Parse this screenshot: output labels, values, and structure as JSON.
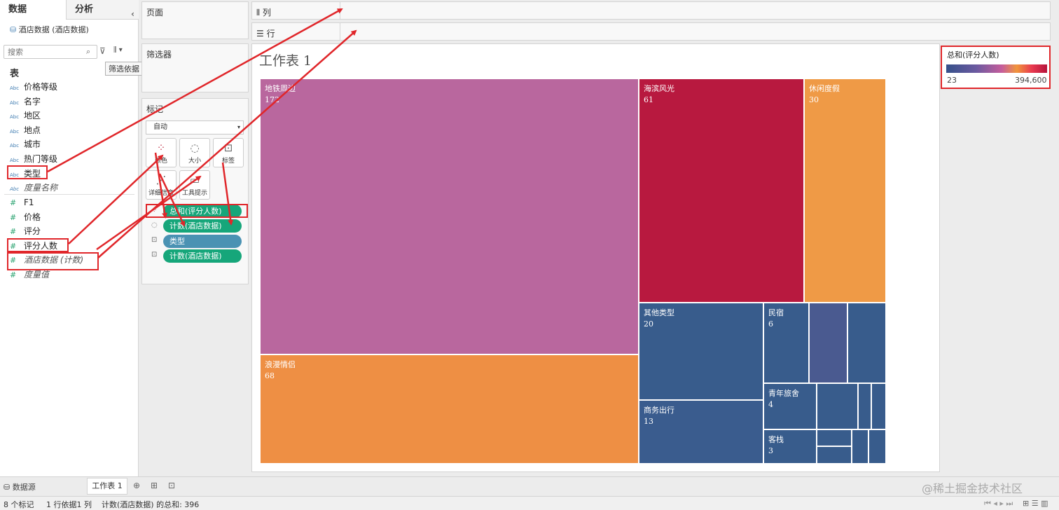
{
  "datapane": {
    "tab_data": "数据",
    "tab_analysis": "分析",
    "collapse": "‹",
    "datasource": "酒店数据 (酒店数据)",
    "search_placeholder": "搜索",
    "tooltip": "筛选依据",
    "tables_header": "表",
    "dimensions": [
      {
        "type": "Abc",
        "label": "价格等级"
      },
      {
        "type": "Abc",
        "label": "名字"
      },
      {
        "type": "Abc",
        "label": "地区"
      },
      {
        "type": "Abc",
        "label": "地点"
      },
      {
        "type": "Abc",
        "label": "城市"
      },
      {
        "type": "Abc",
        "label": "热门等级"
      },
      {
        "type": "Abc",
        "label": "类型"
      },
      {
        "type": "Abc",
        "label": "度量名称"
      }
    ],
    "measures": [
      {
        "type": "#",
        "label": "F1"
      },
      {
        "type": "#",
        "label": "价格"
      },
      {
        "type": "#",
        "label": "评分"
      },
      {
        "type": "#",
        "label": "评分人数"
      },
      {
        "type": "#",
        "label": "酒店数据 (计数)"
      },
      {
        "type": "#",
        "label": "度量值"
      }
    ]
  },
  "shelves": {
    "pages": "页面",
    "filters": "筛选器",
    "marks": "标记",
    "columns": "列",
    "rows": "行"
  },
  "marks": {
    "type": "自动",
    "buttons": [
      {
        "icon": "color-icon",
        "label": "颜色"
      },
      {
        "icon": "size-icon",
        "label": "大小"
      },
      {
        "icon": "label-icon",
        "label": "标签"
      },
      {
        "icon": "detail-icon",
        "label": "详细信息"
      },
      {
        "icon": "tooltip-icon",
        "label": "工具提示"
      }
    ],
    "pills": [
      {
        "label": "总和(评分人数)",
        "color": "green"
      },
      {
        "label": "计数(酒店数据)",
        "color": "green"
      },
      {
        "label": "类型",
        "color": "blue"
      },
      {
        "label": "计数(酒店数据)",
        "color": "green"
      }
    ]
  },
  "view": {
    "sheet_title": "工作表 1"
  },
  "chart_data": {
    "type": "treemap",
    "title": "工作表 1",
    "size_measure": "计数(酒店数据)",
    "color_measure": "总和(评分人数)",
    "cells": [
      {
        "label": "地铁周边",
        "value": 172,
        "color": "#b9679e"
      },
      {
        "label": "浪漫情侣",
        "value": 68,
        "color": "#ee8f44"
      },
      {
        "label": "海滨风光",
        "value": 61,
        "color": "#b8193f"
      },
      {
        "label": "休闲度假",
        "value": 30,
        "color": "#ef9a46"
      },
      {
        "label": "其他类型",
        "value": 20,
        "color": "#385c8c"
      },
      {
        "label": "商务出行",
        "value": 13,
        "color": "#3a5c8e"
      },
      {
        "label": "民宿",
        "value": 6,
        "color": "#385c8c"
      },
      {
        "label": "青年旅舍",
        "value": 4,
        "color": "#385c8c"
      },
      {
        "label": "客栈",
        "value": 3,
        "color": "#385c8c"
      }
    ],
    "legend": {
      "title": "总和(评分人数)",
      "min": "23",
      "max": "394,600"
    }
  },
  "bottom": {
    "datasource_tab": "数据源",
    "sheet_tab": "工作表 1",
    "watermark": "@稀土掘金技术社区",
    "status_marks": "8 个标记",
    "status_rows": "1 行依据1 列",
    "status_sum": "计数(酒店数据) 的总和: 396"
  }
}
